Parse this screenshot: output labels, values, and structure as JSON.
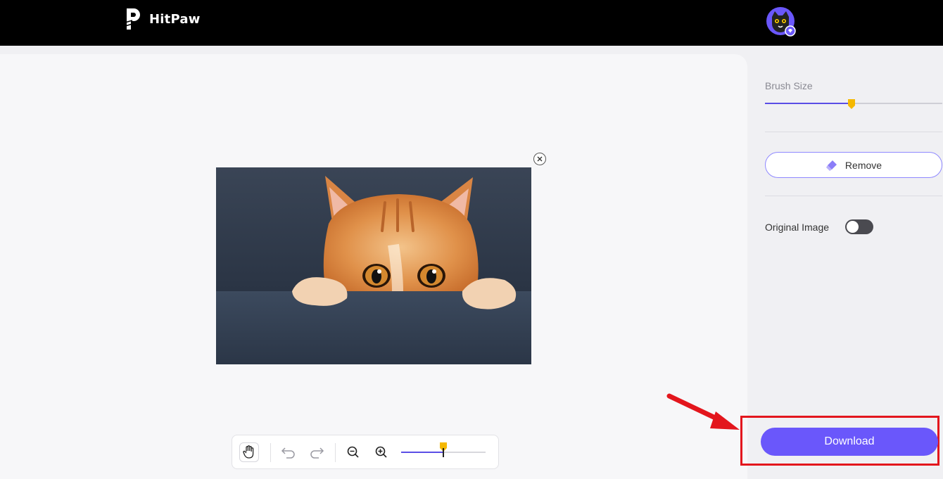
{
  "header": {
    "brand_name": "HitPaw",
    "logo_icon": "hitpaw-logo-icon",
    "avatar_icon": "cat-avatar-icon"
  },
  "canvas": {
    "close_icon": "close-circle-icon",
    "image_alt": "cat peeking over edge"
  },
  "toolbar": {
    "hand_icon": "hand-pan-icon",
    "undo_icon": "undo-icon",
    "redo_icon": "redo-icon",
    "zoom_out_icon": "zoom-out-icon",
    "zoom_in_icon": "zoom-in-icon",
    "zoom_level_fraction": 0.5
  },
  "side": {
    "brush_size_label": "Brush Size",
    "brush_size_fraction": 0.49,
    "remove_label": "Remove",
    "remove_icon": "eraser-icon",
    "original_image_label": "Original Image",
    "original_image_on": false
  },
  "download_label": "Download",
  "colors": {
    "accent": "#6a57fb",
    "slider_thumb": "#f5b800",
    "highlight": "#e3161d"
  }
}
